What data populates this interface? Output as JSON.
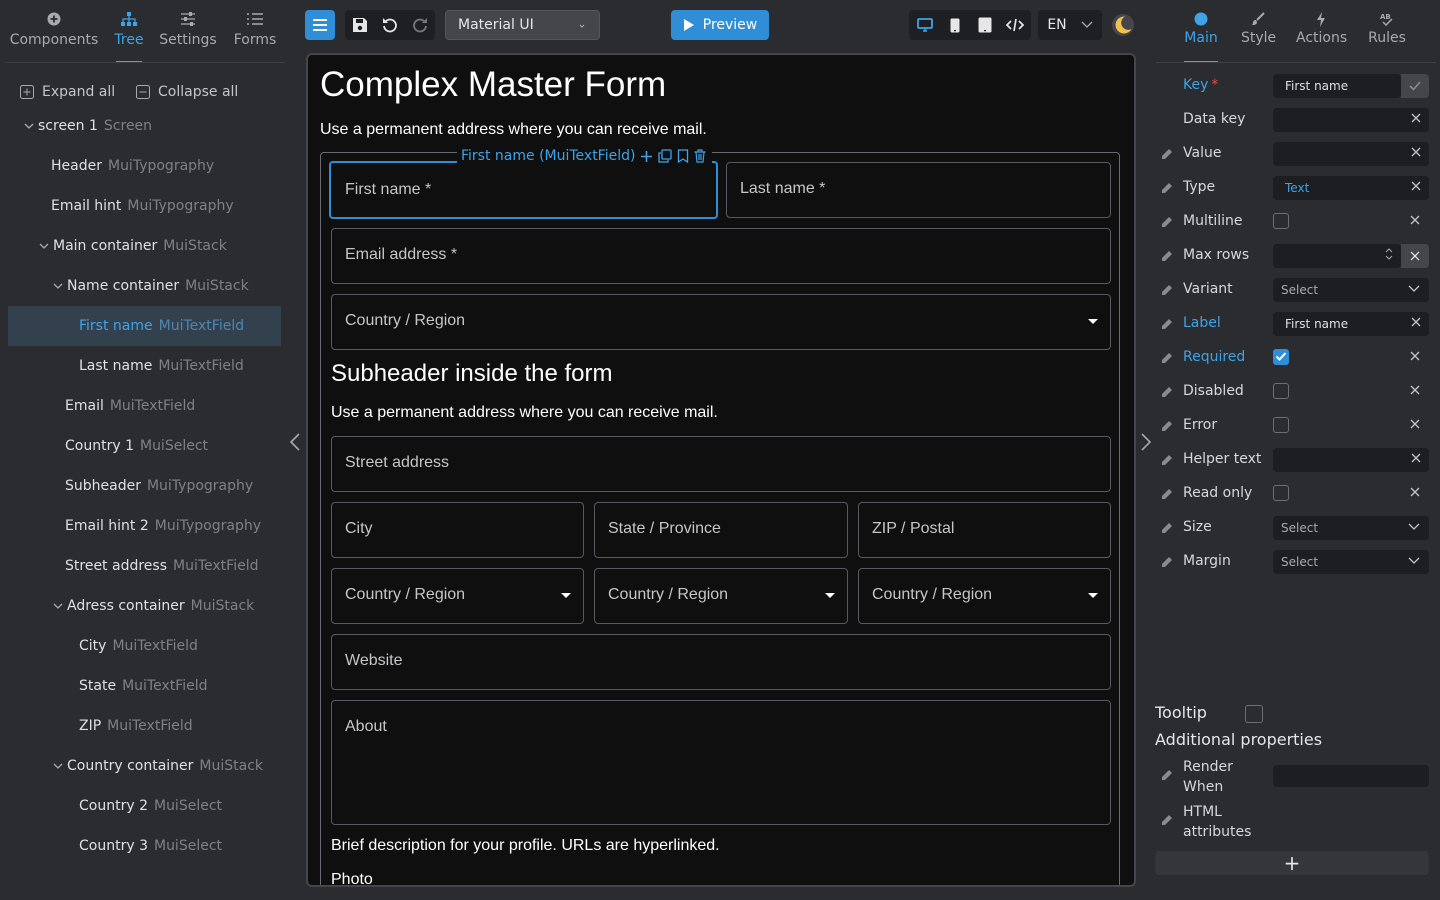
{
  "left_panel": {
    "tabs": [
      {
        "label": "Components",
        "icon": "plus-circle-icon"
      },
      {
        "label": "Tree",
        "icon": "tree-icon"
      },
      {
        "label": "Settings",
        "icon": "sliders-icon"
      },
      {
        "label": "Forms",
        "icon": "list-icon"
      }
    ],
    "active_tab": "Tree",
    "expand_all": "Expand all",
    "collapse_all": "Collapse all",
    "tree": [
      {
        "name": "screen 1",
        "type": "Screen",
        "depth": 0,
        "caret": "expanded"
      },
      {
        "name": "Header",
        "type": "MuiTypography",
        "depth": 1
      },
      {
        "name": "Email hint",
        "type": "MuiTypography",
        "depth": 1
      },
      {
        "name": "Main container",
        "type": "MuiStack",
        "depth": 1,
        "caret": "expanded"
      },
      {
        "name": "Name container",
        "type": "MuiStack",
        "depth": 2,
        "caret": "expanded"
      },
      {
        "name": "First name",
        "type": "MuiTextField",
        "depth": 3,
        "selected": true
      },
      {
        "name": "Last name",
        "type": "MuiTextField",
        "depth": 3
      },
      {
        "name": "Email",
        "type": "MuiTextField",
        "depth": 2
      },
      {
        "name": "Country 1",
        "type": "MuiSelect",
        "depth": 2
      },
      {
        "name": "Subheader",
        "type": "MuiTypography",
        "depth": 2
      },
      {
        "name": "Email hint 2",
        "type": "MuiTypography",
        "depth": 2
      },
      {
        "name": "Street address",
        "type": "MuiTextField",
        "depth": 2
      },
      {
        "name": "Adress container",
        "type": "MuiStack",
        "depth": 2,
        "caret": "expanded"
      },
      {
        "name": "City",
        "type": "MuiTextField",
        "depth": 3
      },
      {
        "name": "State",
        "type": "MuiTextField",
        "depth": 3
      },
      {
        "name": "ZIP",
        "type": "MuiTextField",
        "depth": 3
      },
      {
        "name": "Country container",
        "type": "MuiStack",
        "depth": 2,
        "caret": "expanded"
      },
      {
        "name": "Country 2",
        "type": "MuiSelect",
        "depth": 3
      },
      {
        "name": "Country 3",
        "type": "MuiSelect",
        "depth": 3
      }
    ]
  },
  "toolbar": {
    "theme_select": "Material UI",
    "preview_label": "Preview",
    "language": "EN",
    "accent_color": "#2f8ed6"
  },
  "canvas": {
    "title": "Complex Master Form",
    "hint": "Use a permanent address where you can receive mail.",
    "selection_label": "First name (MuiTextField)",
    "fields": {
      "first_name": "First name *",
      "last_name": "Last name *",
      "email": "Email address *",
      "country_region": "Country / Region",
      "street": "Street address",
      "city": "City",
      "state": "State / Province",
      "zip": "ZIP / Postal",
      "country2": "Country / Region",
      "country3": "Country / Region",
      "country4": "Country / Region",
      "website": "Website",
      "about": "About"
    },
    "subheader": "Subheader inside the form",
    "subheader_hint": "Use a permanent address where you can receive mail.",
    "about_helper": "Brief description for your profile. URLs are hyperlinked.",
    "photo_label": "Photo"
  },
  "right_panel": {
    "tabs": [
      {
        "label": "Main",
        "icon": "circle-icon"
      },
      {
        "label": "Style",
        "icon": "brush-icon"
      },
      {
        "label": "Actions",
        "icon": "bolt-icon"
      },
      {
        "label": "Rules",
        "icon": "rules-icon"
      }
    ],
    "active_tab": "Main",
    "props": {
      "key": {
        "label": "Key",
        "value": "First name"
      },
      "data_key": {
        "label": "Data key",
        "value": ""
      },
      "value": {
        "label": "Value",
        "value": ""
      },
      "type": {
        "label": "Type",
        "value": "Text"
      },
      "multiline": {
        "label": "Multiline",
        "checked": false
      },
      "max_rows": {
        "label": "Max rows",
        "value": ""
      },
      "variant": {
        "label": "Variant",
        "value": "Select"
      },
      "label": {
        "label": "Label",
        "value": "First name"
      },
      "required": {
        "label": "Required",
        "checked": true
      },
      "disabled": {
        "label": "Disabled",
        "checked": false
      },
      "error": {
        "label": "Error",
        "checked": false
      },
      "helper_text": {
        "label": "Helper text",
        "value": ""
      },
      "read_only": {
        "label": "Read only",
        "checked": false
      },
      "size": {
        "label": "Size",
        "value": "Select"
      },
      "margin": {
        "label": "Margin",
        "value": "Select"
      }
    },
    "tooltip_label": "Tooltip",
    "tooltip_checked": false,
    "additional_heading": "Additional properties",
    "render_when": {
      "line1": "Render",
      "line2": "When"
    },
    "html_attributes": {
      "line1": "HTML",
      "line2": "attributes"
    },
    "add_symbol": "+"
  }
}
